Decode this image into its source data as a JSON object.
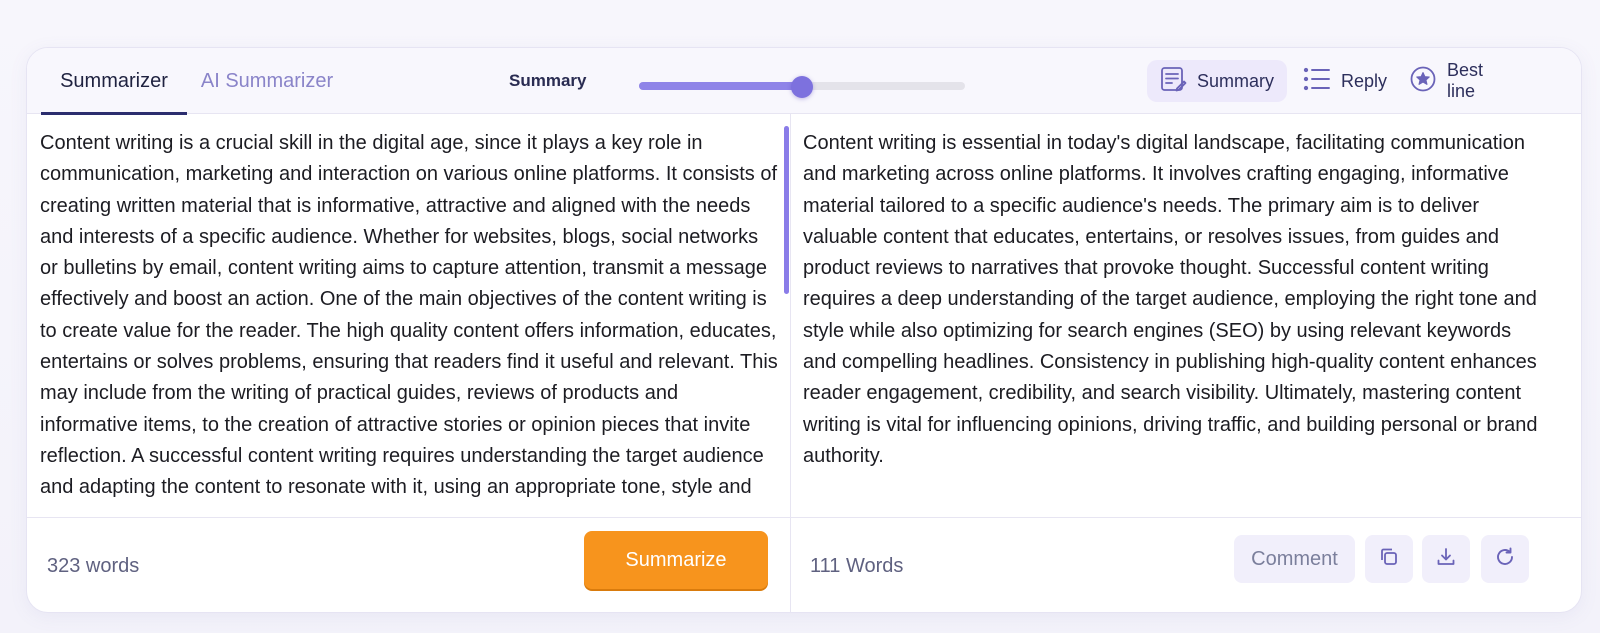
{
  "tabs": {
    "summarizer": "Summarizer",
    "ai_summarizer": "AI Summarizer"
  },
  "length_control": {
    "label": "Summary",
    "level": 0.5
  },
  "modes": {
    "summary": "Summary",
    "reply": "Reply",
    "best_line": "Best line"
  },
  "input": {
    "text": "Content writing is a crucial skill in the digital age, since it plays a key role in communication, marketing and interaction on various online platforms. It consists of creating written material that is informative, attractive and aligned with the needs and interests of a specific audience. Whether for websites, blogs, social networks or bulletins by email, content writing aims to capture attention, transmit a message effectively and boost an action.  One of the main objectives of the content writing is to create value for the reader. The high quality content offers information, educates, entertains or solves problems, ensuring that readers find it useful and relevant. This may include from the writing of practical guides, reviews of products and informative items, to the creation of attractive stories or opinion pieces that invite reflection. A successful content writing requires understanding the target audience and adapting the content to resonate with it, using an appropriate tone, style and",
    "word_count": "323  words",
    "summarize_button": "Summarize"
  },
  "output": {
    "text": "Content writing is essential in today's digital landscape, facilitating communication and marketing across online platforms. It involves crafting engaging, informative material tailored to a specific audience's needs. The primary aim is to deliver valuable content that educates, entertains, or resolves issues, from guides and product reviews to narratives that provoke thought. Successful content writing requires a deep understanding of the target audience, employing the right tone and style while also optimizing for search engines (SEO) by using relevant keywords and compelling headlines. Consistency in publishing high-quality content enhances reader engagement, credibility, and search visibility. Ultimately, mastering content writing is vital for influencing opinions, driving traffic, and building personal or brand authority.",
    "word_count": "111 Words",
    "comment_button": "Comment"
  },
  "colors": {
    "accent": "#7d71de",
    "summarize_button": "#f7941d",
    "active_mode_bg": "#ede9fb"
  },
  "icons": [
    "summary-icon",
    "list-icon",
    "star-circle-icon",
    "copy-icon",
    "download-icon",
    "regenerate-icon"
  ]
}
